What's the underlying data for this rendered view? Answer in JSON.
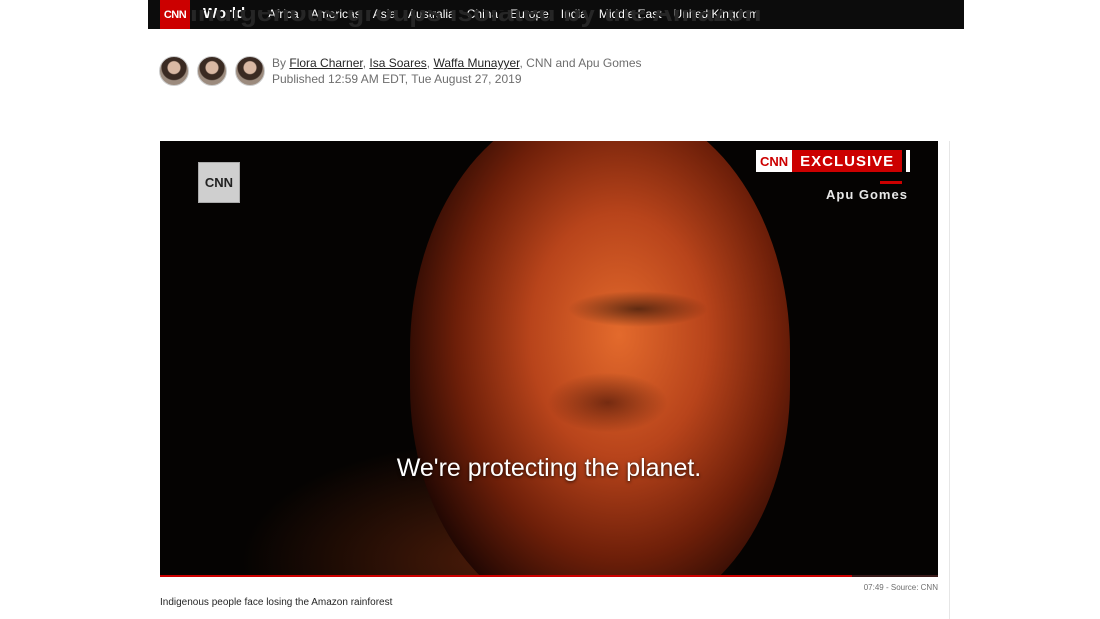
{
  "nav": {
    "logo": "CNN",
    "section": "World",
    "items": [
      "Africa",
      "Americas",
      "Asia",
      "Australia",
      "China",
      "Europe",
      "India",
      "Middle East",
      "United Kingdom"
    ]
  },
  "headline_fragment": "Indigenous groups isolated by the Amazon",
  "byline": {
    "prefix": "By",
    "authors": [
      "Flora Charner",
      "Isa Soares",
      "Waffa Munayyer"
    ],
    "suffix": ", CNN and Apu Gomes",
    "published": "Published 12:59 AM EDT, Tue August 27, 2019"
  },
  "video": {
    "bug_logo": "CNN",
    "exclusive_logo": "CNN",
    "exclusive_label": "EXCLUSIVE",
    "reporter": "Apu Gomes",
    "subtitle": "We're protecting the planet.",
    "progress_fraction": 0.89,
    "duration_source": "07:49 - Source: CNN",
    "caption": "Indigenous people face losing the Amazon rainforest"
  },
  "colors": {
    "brand_red": "#cc0000",
    "nav_bg": "#0c0c0c"
  }
}
